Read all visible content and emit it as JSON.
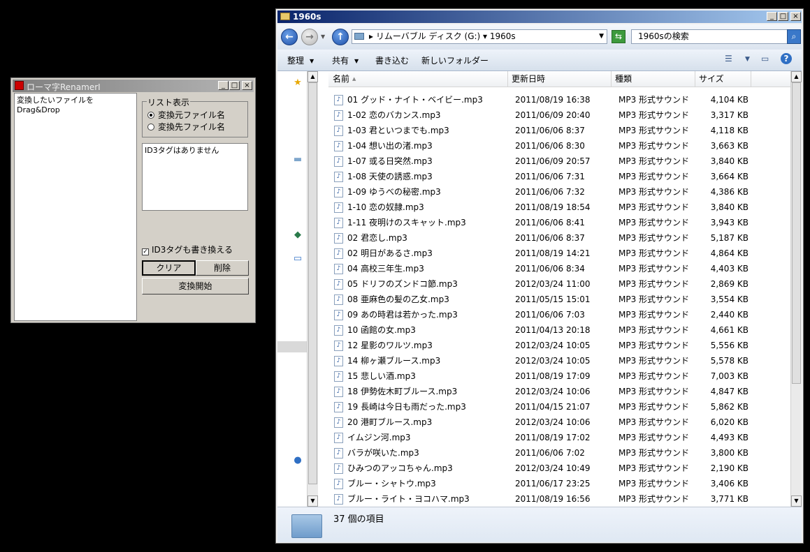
{
  "renamer": {
    "title": "ローマ字RenamerI",
    "btn_min": "_",
    "btn_max": "□",
    "btn_close": "×",
    "drop_hint": "変換したいファイルをDrag&Drop",
    "list_group_label": "リスト表示",
    "radio_source": "変換元ファイル名",
    "radio_dest": "変換先ファイル名",
    "radio_selected": "source",
    "id3_text": "ID3タグはありません",
    "id3_rewrite_label": "ID3タグも書き換える",
    "id3_rewrite_checked": true,
    "clear_label": "クリア",
    "delete_label": "削除",
    "start_label": "変換開始"
  },
  "explorer": {
    "title": "1960s",
    "btn_min": "_",
    "btn_max": "□",
    "btn_close": "×",
    "address": "▸ リムーバブル ディスク (G:) ▾ 1960s",
    "search_placeholder": "1960sの検索",
    "toolbar": {
      "organize": "整理",
      "share": "共有",
      "burn": "書き込む",
      "new_folder": "新しいフォルダー"
    },
    "columns": {
      "name": "名前",
      "date": "更新日時",
      "type": "種類",
      "size": "サイズ"
    },
    "status": "37 個の項目",
    "files": [
      {
        "name": "01 グッド・ナイト・ベイビー.mp3",
        "date": "2011/08/19 16:38",
        "type": "MP3 形式サウンド",
        "size": "4,104 KB"
      },
      {
        "name": "1-02 恋のバカンス.mp3",
        "date": "2011/06/09 20:40",
        "type": "MP3 形式サウンド",
        "size": "3,317 KB"
      },
      {
        "name": "1-03 君といつまでも.mp3",
        "date": "2011/06/06 8:37",
        "type": "MP3 形式サウンド",
        "size": "4,118 KB"
      },
      {
        "name": "1-04 想い出の渚.mp3",
        "date": "2011/06/06 8:30",
        "type": "MP3 形式サウンド",
        "size": "3,663 KB"
      },
      {
        "name": "1-07 或る日突然.mp3",
        "date": "2011/06/09 20:57",
        "type": "MP3 形式サウンド",
        "size": "3,840 KB"
      },
      {
        "name": "1-08 天使の誘惑.mp3",
        "date": "2011/06/06 7:31",
        "type": "MP3 形式サウンド",
        "size": "3,664 KB"
      },
      {
        "name": "1-09 ゆうべの秘密.mp3",
        "date": "2011/06/06 7:32",
        "type": "MP3 形式サウンド",
        "size": "4,386 KB"
      },
      {
        "name": "1-10 恋の奴隷.mp3",
        "date": "2011/08/19 18:54",
        "type": "MP3 形式サウンド",
        "size": "3,840 KB"
      },
      {
        "name": "1-11 夜明けのスキャット.mp3",
        "date": "2011/06/06 8:41",
        "type": "MP3 形式サウンド",
        "size": "3,943 KB"
      },
      {
        "name": "02 君恋し.mp3",
        "date": "2011/06/06 8:37",
        "type": "MP3 形式サウンド",
        "size": "5,187 KB"
      },
      {
        "name": "02 明日があるさ.mp3",
        "date": "2011/08/19 14:21",
        "type": "MP3 形式サウンド",
        "size": "4,864 KB"
      },
      {
        "name": "04 高校三年生.mp3",
        "date": "2011/06/06 8:34",
        "type": "MP3 形式サウンド",
        "size": "4,403 KB"
      },
      {
        "name": "05 ドリフのズンドコ節.mp3",
        "date": "2012/03/24 11:00",
        "type": "MP3 形式サウンド",
        "size": "2,869 KB"
      },
      {
        "name": "08 亜麻色の髪の乙女.mp3",
        "date": "2011/05/15 15:01",
        "type": "MP3 形式サウンド",
        "size": "3,554 KB"
      },
      {
        "name": "09 あの時君は若かった.mp3",
        "date": "2011/06/06 7:03",
        "type": "MP3 形式サウンド",
        "size": "2,440 KB"
      },
      {
        "name": "10 函館の女.mp3",
        "date": "2011/04/13 20:18",
        "type": "MP3 形式サウンド",
        "size": "4,661 KB"
      },
      {
        "name": "12 星影のワルツ.mp3",
        "date": "2012/03/24 10:05",
        "type": "MP3 形式サウンド",
        "size": "5,556 KB"
      },
      {
        "name": "14 柳ヶ瀬ブルース.mp3",
        "date": "2012/03/24 10:05",
        "type": "MP3 形式サウンド",
        "size": "5,578 KB"
      },
      {
        "name": "15 悲しい酒.mp3",
        "date": "2011/08/19 17:09",
        "type": "MP3 形式サウンド",
        "size": "7,003 KB"
      },
      {
        "name": "18 伊勢佐木町ブルース.mp3",
        "date": "2012/03/24 10:06",
        "type": "MP3 形式サウンド",
        "size": "4,847 KB"
      },
      {
        "name": "19 長崎は今日も雨だった.mp3",
        "date": "2011/04/15 21:07",
        "type": "MP3 形式サウンド",
        "size": "5,862 KB"
      },
      {
        "name": "20 港町ブルース.mp3",
        "date": "2012/03/24 10:06",
        "type": "MP3 形式サウンド",
        "size": "6,020 KB"
      },
      {
        "name": "イムジン河.mp3",
        "date": "2011/08/19 17:02",
        "type": "MP3 形式サウンド",
        "size": "4,493 KB"
      },
      {
        "name": "バラが咲いた.mp3",
        "date": "2011/06/06 7:02",
        "type": "MP3 形式サウンド",
        "size": "3,800 KB"
      },
      {
        "name": "ひみつのアッコちゃん.mp3",
        "date": "2012/03/24 10:49",
        "type": "MP3 形式サウンド",
        "size": "2,190 KB"
      },
      {
        "name": "ブルー・シャトウ.mp3",
        "date": "2011/06/17 23:25",
        "type": "MP3 形式サウンド",
        "size": "3,406 KB"
      },
      {
        "name": "ブルー・ライト・ヨコハマ.mp3",
        "date": "2011/08/19 16:56",
        "type": "MP3 形式サウンド",
        "size": "3,771 KB"
      }
    ]
  },
  "icons": {
    "file": "♪",
    "favorites": "★",
    "back": "←",
    "forward": "→",
    "up": "↑",
    "refresh": "⇆",
    "search": "⌕",
    "help": "?",
    "views": "☰",
    "preview": "▭",
    "network": "◆",
    "computer": "▭",
    "globe": "●",
    "arrow_up": "▲",
    "arrow_down": "▼",
    "caret": "▼",
    "check": "✓"
  }
}
